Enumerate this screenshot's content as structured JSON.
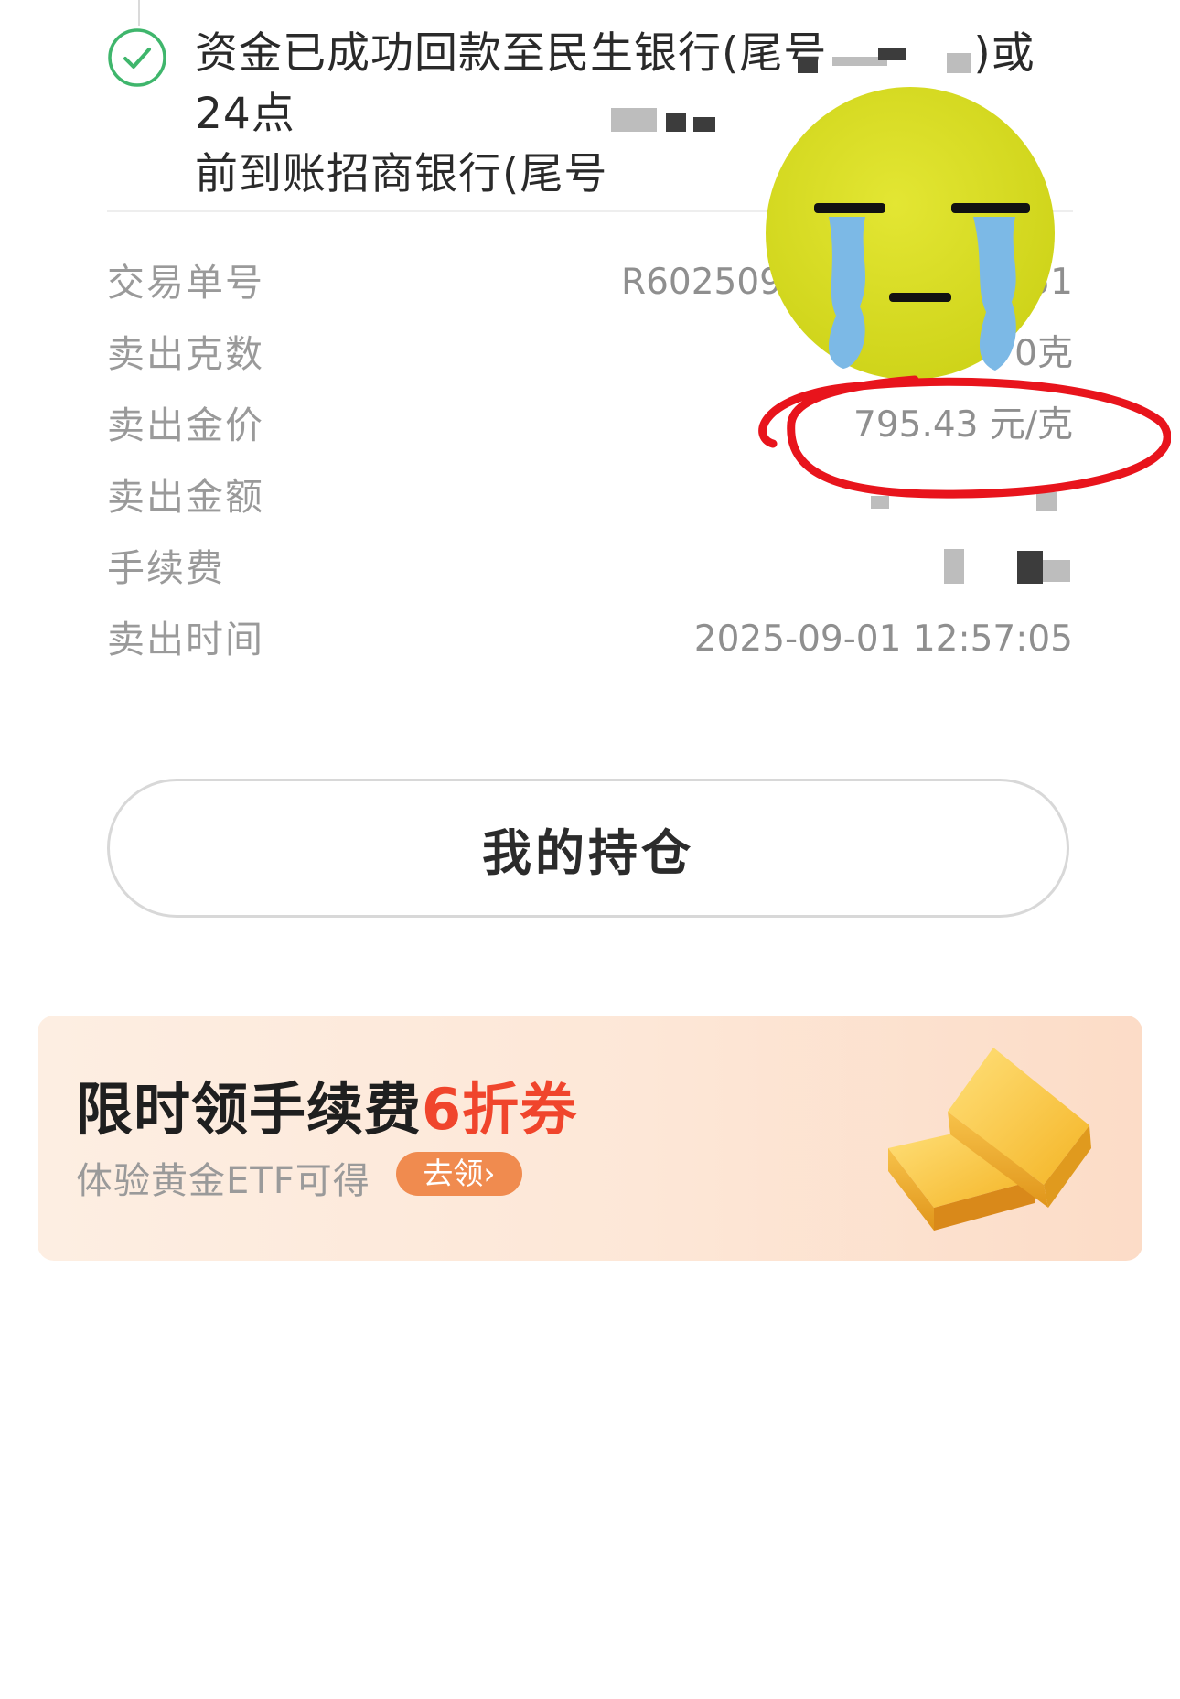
{
  "status": {
    "message_line1": "资金已成功回款至民生银行(尾号",
    "message_line1_end": ")或24点",
    "message_line2": "前到账招商银行(尾号"
  },
  "details": {
    "rows": [
      {
        "label": "交易单号",
        "value": "R602509"
      },
      {
        "label": "卖出克数",
        "value": "0克"
      },
      {
        "label": "卖出金价",
        "value": "795.43 元/克"
      },
      {
        "label": "卖出金额",
        "value": ""
      },
      {
        "label": "手续费",
        "value": ""
      },
      {
        "label": "卖出时间",
        "value": "2025-09-01 12:57:05"
      }
    ],
    "order_id_suffix": "51"
  },
  "actions": {
    "holdings_label": "我的持仓"
  },
  "promo": {
    "title_prefix": "限时领手续费",
    "title_highlight": "6折券",
    "subtitle": "体验黄金ETF可得",
    "claim_label": "去领",
    "claim_arrow": "›"
  },
  "colors": {
    "success_green": "#3fb66c",
    "highlight_red": "#f0452c",
    "claim_orange": "#f08b4f",
    "annotation_red": "#e8141c",
    "emoji_yellow": "#d9dd1f",
    "tear_blue": "#7cb9e6"
  },
  "icons": {
    "status": "check-circle-icon",
    "promo": "gold-bars-icon",
    "sticker": "crying-face-icon",
    "annotation": "red-circle-annotation"
  }
}
